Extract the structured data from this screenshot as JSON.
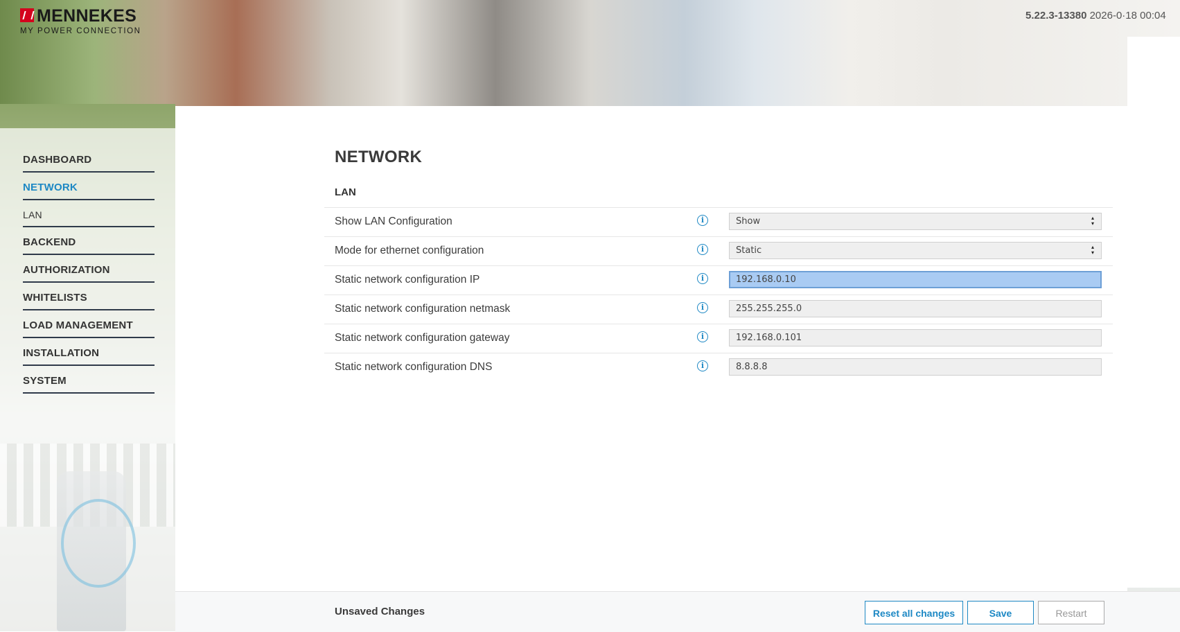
{
  "brand": {
    "name": "MENNEKES",
    "tagline": "MY POWER CONNECTION"
  },
  "version": {
    "number": "5.22.3-13380",
    "datetime": "2026-0·18 00:04"
  },
  "sidebar": {
    "items": [
      {
        "label": "DASHBOARD",
        "active": false,
        "sub": false
      },
      {
        "label": "NETWORK",
        "active": true,
        "sub": false
      },
      {
        "label": "LAN",
        "active": false,
        "sub": true
      },
      {
        "label": "BACKEND",
        "active": false,
        "sub": false
      },
      {
        "label": "AUTHORIZATION",
        "active": false,
        "sub": false
      },
      {
        "label": "WHITELISTS",
        "active": false,
        "sub": false
      },
      {
        "label": "LOAD MANAGEMENT",
        "active": false,
        "sub": false
      },
      {
        "label": "INSTALLATION",
        "active": false,
        "sub": false
      },
      {
        "label": "SYSTEM",
        "active": false,
        "sub": false
      }
    ]
  },
  "main": {
    "title": "NETWORK",
    "section": "LAN",
    "rows": [
      {
        "label": "Show LAN Configuration",
        "value": "Show",
        "type": "select"
      },
      {
        "label": "Mode for ethernet configuration",
        "value": "Static",
        "type": "select"
      },
      {
        "label": "Static network configuration IP",
        "value": "192.168.0.10",
        "type": "input",
        "focused": true
      },
      {
        "label": "Static network configuration netmask",
        "value": "255.255.255.0",
        "type": "input"
      },
      {
        "label": "Static network configuration gateway",
        "value": "192.168.0.101",
        "type": "input"
      },
      {
        "label": "Static network configuration DNS",
        "value": "8.8.8.8",
        "type": "input"
      }
    ]
  },
  "footer": {
    "status": "Unsaved Changes",
    "reset_label": "Reset all changes",
    "save_label": "Save",
    "restart_label": "Restart"
  },
  "colors": {
    "accent": "#1d88c4",
    "brand_red": "#d4021d",
    "focus_bg": "#a9cbf3"
  }
}
